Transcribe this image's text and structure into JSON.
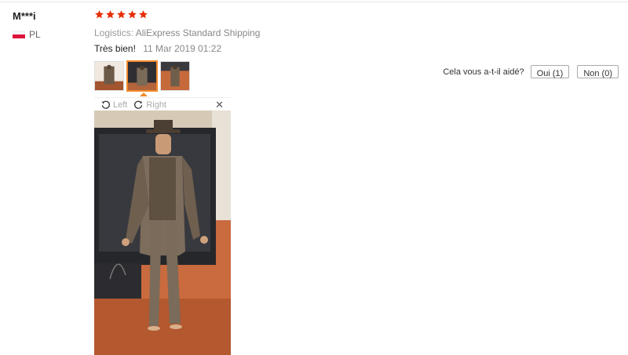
{
  "reviewer": {
    "name": "M***i",
    "country_code": "PL",
    "flag": "poland-flag-icon"
  },
  "rating": {
    "stars": 5,
    "max": 5,
    "color": "#e62e04"
  },
  "logistics": {
    "label": "Logistics:",
    "value": "AliExpress Standard Shipping"
  },
  "feedback": {
    "comment": "Très bien!",
    "date": "11 Mar 2019 01:22"
  },
  "images": {
    "count": 3,
    "selected_index": 1,
    "accent": "#f28a2b"
  },
  "viewer": {
    "rotate_left": "Left",
    "rotate_right": "Right",
    "close_icon": "close-icon"
  },
  "helpful": {
    "question": "Cela vous a-t-il aidé?",
    "yes_label": "Oui (1)",
    "no_label": "Non (0)"
  }
}
